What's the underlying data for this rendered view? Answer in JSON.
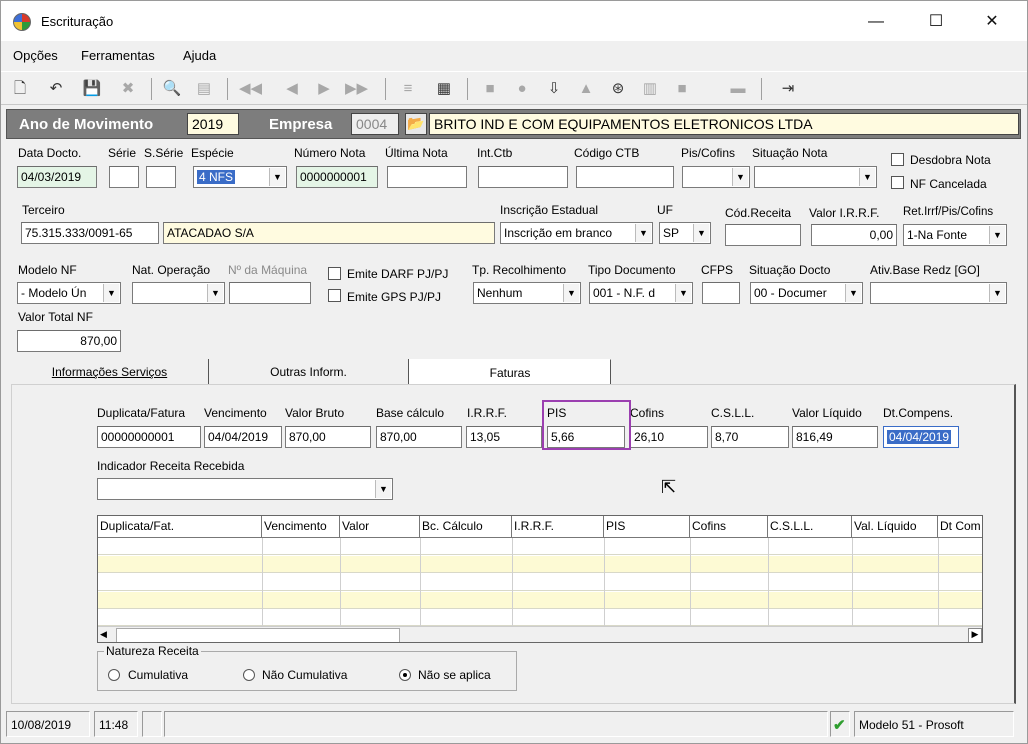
{
  "window": {
    "title": "Escrituração",
    "controls": {
      "minimize": "—",
      "maximize": "☐",
      "close": "✕"
    }
  },
  "menu": {
    "items": [
      "Opções",
      "Ferramentas",
      "Ajuda"
    ]
  },
  "toolbar": {
    "icons": [
      "new-document-icon",
      "undo-icon",
      "save-icon",
      "delete-icon",
      "print-preview-icon",
      "nf-icon",
      "first-record-icon",
      "previous-record-icon",
      "next-record-icon",
      "last-record-icon",
      "list-icon",
      "calculator-icon",
      "folder-icon",
      "apple-icon",
      "export-icon",
      "cloud-icon",
      "cdb-icon",
      "columns-icon",
      "grid-icon",
      "minus-icon",
      "exit-icon"
    ]
  },
  "header_band": {
    "ano_label": "Ano de Movimento",
    "ano_value": "2019",
    "empresa_label": "Empresa",
    "empresa_code": "0004",
    "empresa_name": "BRITO IND E COM EQUIPAMENTOS ELETRONICOS LTDA"
  },
  "row1": {
    "data_docto_label": "Data Docto.",
    "data_docto_value": "04/03/2019",
    "serie_label": "Série",
    "sserie_label": "S.Série",
    "especie_label": "Espécie",
    "especie_value": "4 NFS",
    "numero_nota_label": "Número Nota",
    "numero_nota_value": "0000000001",
    "ultima_nota_label": "Última Nota",
    "int_ctb_label": "Int.Ctb",
    "codigo_ctb_label": "Código CTB",
    "pis_cofins_label": "Pis/Cofins",
    "situacao_nota_label": "Situação Nota",
    "desdobra_nota_label": "Desdobra Nota",
    "nf_cancelada_label": "NF Cancelada"
  },
  "row2": {
    "terceiro_label": "Terceiro",
    "terceiro_cnpj": "75.315.333/0091-65",
    "terceiro_nome": "ATACADAO S/A",
    "inscricao_label": "Inscrição Estadual",
    "inscricao_value": "Inscrição em branco",
    "uf_label": "UF",
    "uf_value": "SP",
    "cod_receita_label": "Cód.Receita",
    "valor_irrf_label": "Valor I.R.R.F.",
    "valor_irrf_value": "0,00",
    "ret_irrf_label": "Ret.Irrf/Pis/Cofins",
    "ret_irrf_value": "1-Na Fonte"
  },
  "row3": {
    "modelo_nf_label": "Modelo NF",
    "modelo_nf_value": "- Modelo Ún",
    "nat_operacao_label": "Nat. Operação",
    "num_maquina_label": "Nº da Máquina",
    "emite_darf_label": "Emite DARF PJ/PJ",
    "emite_gps_label": "Emite GPS PJ/PJ",
    "tp_recolhimento_label": "Tp. Recolhimento",
    "tp_recolhimento_value": "Nenhum",
    "tipo_documento_label": "Tipo Documento",
    "tipo_documento_value": "001 - N.F. d",
    "cfps_label": "CFPS",
    "situacao_docto_label": "Situação Docto",
    "situacao_docto_value": "00 - Documer",
    "ativ_base_label": "Ativ.Base Redz [GO]"
  },
  "row4": {
    "valor_total_label": "Valor Total NF",
    "valor_total_value": "870,00"
  },
  "tabs": [
    "Informações Serviços",
    "Outras Inform.",
    "Faturas"
  ],
  "faturas": {
    "labels": {
      "duplicata": "Duplicata/Fatura",
      "vencimento": "Vencimento",
      "valor_bruto": "Valor Bruto",
      "base_calculo": "Base cálculo",
      "irrf": "I.R.R.F.",
      "pis": "PIS",
      "cofins": "Cofins",
      "csll": "C.S.L.L.",
      "valor_liquido": "Valor Líquido",
      "dt_compens": "Dt.Compens."
    },
    "values": {
      "duplicata": "00000000001",
      "vencimento": "04/04/2019",
      "valor_bruto": "870,00",
      "base_calculo": "870,00",
      "irrf": "13,05",
      "pis": "5,66",
      "cofins": "26,10",
      "csll": "8,70",
      "valor_liquido": "816,49",
      "dt_compens": "04/04/2019"
    },
    "indicador_label": "Indicador Receita Recebida",
    "grid_headers": [
      "Duplicata/Fat.",
      "Vencimento",
      "Valor",
      "Bc. Cálculo",
      "I.R.R.F.",
      "PIS",
      "Cofins",
      "C.S.L.L.",
      "Val. Líquido",
      "Dt Com"
    ],
    "natureza_title": "Natureza Receita",
    "natureza_options": [
      "Cumulativa",
      "Não Cumulativa",
      "Não se aplica"
    ]
  },
  "statusbar": {
    "date": "10/08/2019",
    "time": "11:48",
    "model": "Modelo 51 - Prosoft"
  }
}
